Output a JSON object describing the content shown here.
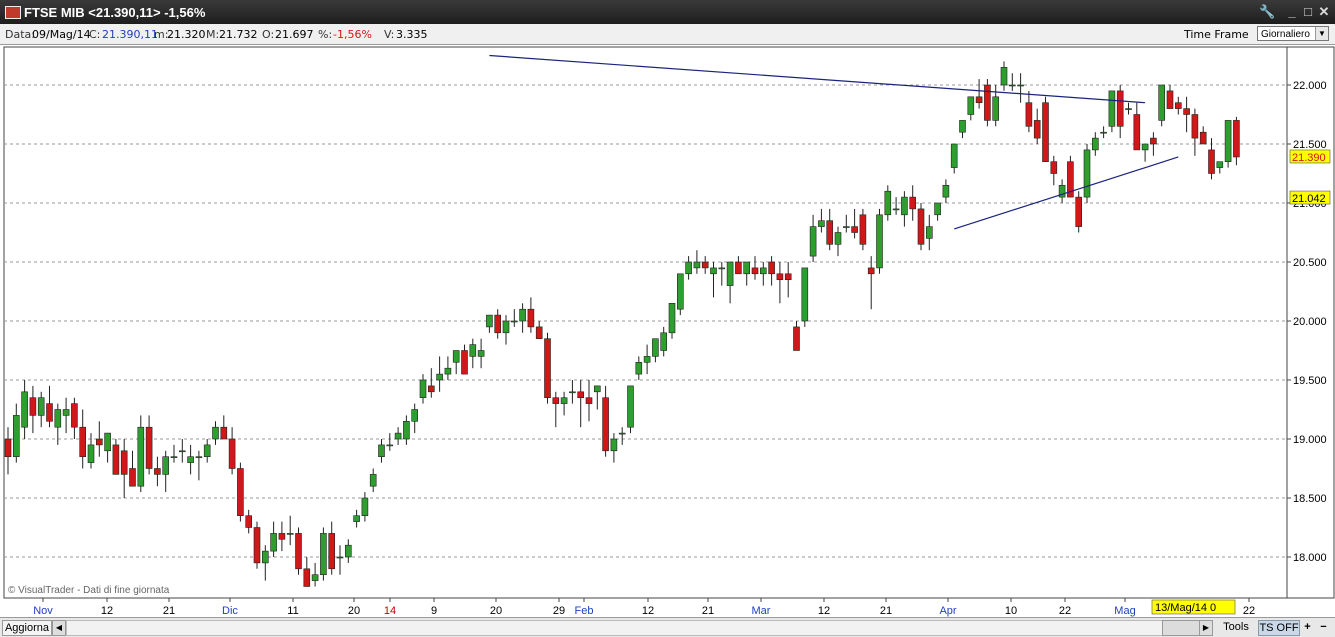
{
  "window": {
    "title": "FTSE MIB <21.390,11>  -1,56%",
    "buttons": [
      "🔧",
      "_",
      "□",
      "✕"
    ]
  },
  "info": {
    "date_label": "Data:",
    "date": "09/Mag/14",
    "close_label": "C:",
    "close": "21.390,11",
    "min_label": "m:",
    "min": "21.320",
    "max_label": "M:",
    "max": "21.732",
    "open_label": "O:",
    "open": "21.697",
    "pct_label": "%:",
    "pct": "-1,56%",
    "vol_label": "V:",
    "vol": "3.335",
    "timeframe_label": "Time Frame",
    "timeframe_value": "Giornaliero"
  },
  "chart_data": {
    "type": "candlestick",
    "y_ticks": [
      "22.000",
      "21.500",
      "21.000",
      "20.500",
      "20.000",
      "19.500",
      "19.000",
      "18.500",
      "18.000"
    ],
    "ylim": [
      17.7,
      22.3
    ],
    "x_labels": [
      {
        "text": "Nov",
        "color": "#1f3fbf"
      },
      {
        "text": "12",
        "color": "#000"
      },
      {
        "text": "21",
        "color": "#000"
      },
      {
        "text": "Dic",
        "color": "#1f3fbf"
      },
      {
        "text": "11",
        "color": "#000"
      },
      {
        "text": "20",
        "color": "#000"
      },
      {
        "text": "14",
        "color": "#c00000"
      },
      {
        "text": "9",
        "color": "#000"
      },
      {
        "text": "20",
        "color": "#000"
      },
      {
        "text": "29",
        "color": "#000"
      },
      {
        "text": "Feb",
        "color": "#1f3fbf"
      },
      {
        "text": "12",
        "color": "#000"
      },
      {
        "text": "21",
        "color": "#000"
      },
      {
        "text": "Mar",
        "color": "#1f3fbf"
      },
      {
        "text": "12",
        "color": "#000"
      },
      {
        "text": "21",
        "color": "#000"
      },
      {
        "text": "Apr",
        "color": "#1f3fbf"
      },
      {
        "text": "10",
        "color": "#000"
      },
      {
        "text": "22",
        "color": "#000"
      },
      {
        "text": "Mag",
        "color": "#1f3fbf"
      },
      {
        "text": "22",
        "color": "#000"
      }
    ],
    "price_tag": "21.390",
    "level_tag": "21.042",
    "date_tag": "13/Mag/14 0",
    "copyright": "© VisualTrader - Dati di fine giornata",
    "colors": {
      "up": "#2e9e2e",
      "down": "#d01818",
      "trendline": "#1a237e",
      "grid": "#9a9a9a"
    },
    "trendlines": [
      {
        "from": [
          58,
          22.25
        ],
        "to": [
          137,
          21.85
        ]
      },
      {
        "from": [
          114,
          20.78
        ],
        "to": [
          141,
          21.39
        ]
      }
    ],
    "candles": [
      [
        19.0,
        19.1,
        18.7,
        18.85
      ],
      [
        18.85,
        19.3,
        18.8,
        19.2
      ],
      [
        19.1,
        19.5,
        19.0,
        19.4
      ],
      [
        19.35,
        19.45,
        19.05,
        19.2
      ],
      [
        19.2,
        19.4,
        19.1,
        19.35
      ],
      [
        19.3,
        19.45,
        19.1,
        19.15
      ],
      [
        19.1,
        19.3,
        18.95,
        19.25
      ],
      [
        19.2,
        19.35,
        19.05,
        19.25
      ],
      [
        19.3,
        19.35,
        19.0,
        19.1
      ],
      [
        19.1,
        19.25,
        18.75,
        18.85
      ],
      [
        18.8,
        19.05,
        18.75,
        18.95
      ],
      [
        19.0,
        19.15,
        18.85,
        18.95
      ],
      [
        18.9,
        19.0,
        18.8,
        19.05
      ],
      [
        18.95,
        19.0,
        18.7,
        18.7
      ],
      [
        18.9,
        19.0,
        18.5,
        18.7
      ],
      [
        18.75,
        18.9,
        18.6,
        18.6
      ],
      [
        18.6,
        19.2,
        18.55,
        19.1
      ],
      [
        19.1,
        19.2,
        18.7,
        18.75
      ],
      [
        18.75,
        18.85,
        18.6,
        18.7
      ],
      [
        18.7,
        18.9,
        18.55,
        18.85
      ],
      [
        18.85,
        18.95,
        18.8,
        18.85
      ],
      [
        18.9,
        19.0,
        18.8,
        18.9
      ],
      [
        18.8,
        18.95,
        18.7,
        18.85
      ],
      [
        18.85,
        18.9,
        18.65,
        18.85
      ],
      [
        18.85,
        19.0,
        18.8,
        18.95
      ],
      [
        19.0,
        19.15,
        18.95,
        19.1
      ],
      [
        19.1,
        19.2,
        19.0,
        19.0
      ],
      [
        19.0,
        19.1,
        18.7,
        18.75
      ],
      [
        18.75,
        18.8,
        18.3,
        18.35
      ],
      [
        18.35,
        18.4,
        18.2,
        18.25
      ],
      [
        18.25,
        18.3,
        17.9,
        17.95
      ],
      [
        17.95,
        18.1,
        17.8,
        18.05
      ],
      [
        18.05,
        18.3,
        18.0,
        18.2
      ],
      [
        18.2,
        18.3,
        18.05,
        18.15
      ],
      [
        18.2,
        18.35,
        18.1,
        18.2
      ],
      [
        18.2,
        18.25,
        17.85,
        17.9
      ],
      [
        17.9,
        18.0,
        17.75,
        17.75
      ],
      [
        17.8,
        17.95,
        17.75,
        17.85
      ],
      [
        17.85,
        18.25,
        17.8,
        18.2
      ],
      [
        18.2,
        18.3,
        17.85,
        17.9
      ],
      [
        18.0,
        18.1,
        17.85,
        18.0
      ],
      [
        18.0,
        18.15,
        17.95,
        18.1
      ],
      [
        18.3,
        18.4,
        18.25,
        18.35
      ],
      [
        18.35,
        18.55,
        18.3,
        18.5
      ],
      [
        18.6,
        18.75,
        18.55,
        18.7
      ],
      [
        18.85,
        19.0,
        18.8,
        18.95
      ],
      [
        18.95,
        19.05,
        18.9,
        18.95
      ],
      [
        19.0,
        19.1,
        18.95,
        19.05
      ],
      [
        19.0,
        19.2,
        18.95,
        19.15
      ],
      [
        19.15,
        19.3,
        19.05,
        19.25
      ],
      [
        19.35,
        19.55,
        19.3,
        19.5
      ],
      [
        19.45,
        19.6,
        19.35,
        19.4
      ],
      [
        19.5,
        19.7,
        19.4,
        19.55
      ],
      [
        19.55,
        19.7,
        19.5,
        19.6
      ],
      [
        19.65,
        19.75,
        19.55,
        19.75
      ],
      [
        19.75,
        19.8,
        19.6,
        19.55
      ],
      [
        19.7,
        19.85,
        19.6,
        19.8
      ],
      [
        19.7,
        19.85,
        19.6,
        19.75
      ],
      [
        19.95,
        20.05,
        19.9,
        20.05
      ],
      [
        20.05,
        20.1,
        19.85,
        19.9
      ],
      [
        19.9,
        20.05,
        19.8,
        20.0
      ],
      [
        20.0,
        20.1,
        19.95,
        20.0
      ],
      [
        20.0,
        20.15,
        19.9,
        20.1
      ],
      [
        20.1,
        20.2,
        19.9,
        19.95
      ],
      [
        19.95,
        20.0,
        19.85,
        19.85
      ],
      [
        19.85,
        19.9,
        19.3,
        19.35
      ],
      [
        19.35,
        19.4,
        19.1,
        19.3
      ],
      [
        19.3,
        19.4,
        19.2,
        19.35
      ],
      [
        19.4,
        19.5,
        19.3,
        19.4
      ],
      [
        19.4,
        19.5,
        19.1,
        19.35
      ],
      [
        19.35,
        19.5,
        19.15,
        19.3
      ],
      [
        19.4,
        19.45,
        19.25,
        19.45
      ],
      [
        19.35,
        19.45,
        18.85,
        18.9
      ],
      [
        18.9,
        19.05,
        18.8,
        19.0
      ],
      [
        19.05,
        19.1,
        18.95,
        19.05
      ],
      [
        19.1,
        19.45,
        19.05,
        19.45
      ],
      [
        19.55,
        19.7,
        19.5,
        19.65
      ],
      [
        19.65,
        19.8,
        19.55,
        19.7
      ],
      [
        19.7,
        19.85,
        19.65,
        19.85
      ],
      [
        19.75,
        19.95,
        19.7,
        19.9
      ],
      [
        19.9,
        20.15,
        19.85,
        20.15
      ],
      [
        20.1,
        20.4,
        20.05,
        20.4
      ],
      [
        20.4,
        20.55,
        20.35,
        20.5
      ],
      [
        20.45,
        20.6,
        20.4,
        20.5
      ],
      [
        20.5,
        20.55,
        20.4,
        20.45
      ],
      [
        20.4,
        20.5,
        20.2,
        20.45
      ],
      [
        20.45,
        20.5,
        20.3,
        20.45
      ],
      [
        20.3,
        20.5,
        20.15,
        20.5
      ],
      [
        20.5,
        20.55,
        20.4,
        20.4
      ],
      [
        20.4,
        20.5,
        20.3,
        20.5
      ],
      [
        20.45,
        20.55,
        20.35,
        20.4
      ],
      [
        20.4,
        20.5,
        20.3,
        20.45
      ],
      [
        20.5,
        20.55,
        20.3,
        20.4
      ],
      [
        20.4,
        20.5,
        20.15,
        20.35
      ],
      [
        20.4,
        20.5,
        20.2,
        20.35
      ],
      [
        19.95,
        20.0,
        19.75,
        19.75
      ],
      [
        20.0,
        20.45,
        19.95,
        20.45
      ],
      [
        20.55,
        20.9,
        20.5,
        20.8
      ],
      [
        20.8,
        20.95,
        20.75,
        20.85
      ],
      [
        20.85,
        20.95,
        20.6,
        20.65
      ],
      [
        20.65,
        20.8,
        20.55,
        20.75
      ],
      [
        20.8,
        20.9,
        20.75,
        20.8
      ],
      [
        20.8,
        20.95,
        20.7,
        20.75
      ],
      [
        20.9,
        20.95,
        20.6,
        20.65
      ],
      [
        20.45,
        20.55,
        20.1,
        20.4
      ],
      [
        20.45,
        20.95,
        20.4,
        20.9
      ],
      [
        20.9,
        21.15,
        20.85,
        21.1
      ],
      [
        20.95,
        21.05,
        20.9,
        20.95
      ],
      [
        20.9,
        21.1,
        20.8,
        21.05
      ],
      [
        21.05,
        21.15,
        20.85,
        20.95
      ],
      [
        20.95,
        21.0,
        20.6,
        20.65
      ],
      [
        20.7,
        20.9,
        20.6,
        20.8
      ],
      [
        20.9,
        21.0,
        20.85,
        21.0
      ],
      [
        21.05,
        21.2,
        21.0,
        21.15
      ],
      [
        21.3,
        21.5,
        21.25,
        21.5
      ],
      [
        21.6,
        21.7,
        21.55,
        21.7
      ],
      [
        21.75,
        21.9,
        21.7,
        21.9
      ],
      [
        21.9,
        22.05,
        21.8,
        21.85
      ],
      [
        22.0,
        22.05,
        21.65,
        21.7
      ],
      [
        21.7,
        22.0,
        21.65,
        21.9
      ],
      [
        22.0,
        22.2,
        21.95,
        22.15
      ],
      [
        22.0,
        22.1,
        21.95,
        22.0
      ],
      [
        22.0,
        22.1,
        21.85,
        22.0
      ],
      [
        21.85,
        21.95,
        21.6,
        21.65
      ],
      [
        21.7,
        21.8,
        21.5,
        21.55
      ],
      [
        21.85,
        21.9,
        21.35,
        21.35
      ],
      [
        21.35,
        21.4,
        21.15,
        21.25
      ],
      [
        21.05,
        21.2,
        21.0,
        21.15
      ],
      [
        21.35,
        21.4,
        21.05,
        21.05
      ],
      [
        21.05,
        21.1,
        20.75,
        20.8
      ],
      [
        21.05,
        21.5,
        21.0,
        21.45
      ],
      [
        21.45,
        21.6,
        21.4,
        21.55
      ],
      [
        21.6,
        21.65,
        21.55,
        21.6
      ],
      [
        21.65,
        21.95,
        21.6,
        21.95
      ],
      [
        21.95,
        22.0,
        21.55,
        21.65
      ],
      [
        21.8,
        21.85,
        21.75,
        21.8
      ],
      [
        21.75,
        21.85,
        21.45,
        21.45
      ],
      [
        21.45,
        21.5,
        21.35,
        21.5
      ],
      [
        21.55,
        21.6,
        21.4,
        21.5
      ],
      [
        21.7,
        22.0,
        21.65,
        22.0
      ],
      [
        21.95,
        22.0,
        21.8,
        21.8
      ],
      [
        21.85,
        21.9,
        21.75,
        21.8
      ],
      [
        21.8,
        21.9,
        21.6,
        21.75
      ],
      [
        21.75,
        21.8,
        21.4,
        21.55
      ],
      [
        21.6,
        21.65,
        21.5,
        21.5
      ],
      [
        21.45,
        21.55,
        21.2,
        21.25
      ],
      [
        21.3,
        21.35,
        21.25,
        21.35
      ],
      [
        21.35,
        21.45,
        21.3,
        21.7
      ],
      [
        21.7,
        21.73,
        21.32,
        21.39
      ]
    ]
  },
  "bottom": {
    "refresh_label": "Aggiorna",
    "tools_label": "Tools",
    "ts_label": "TS OFF",
    "plus_label": "+",
    "minus_label": "−"
  }
}
